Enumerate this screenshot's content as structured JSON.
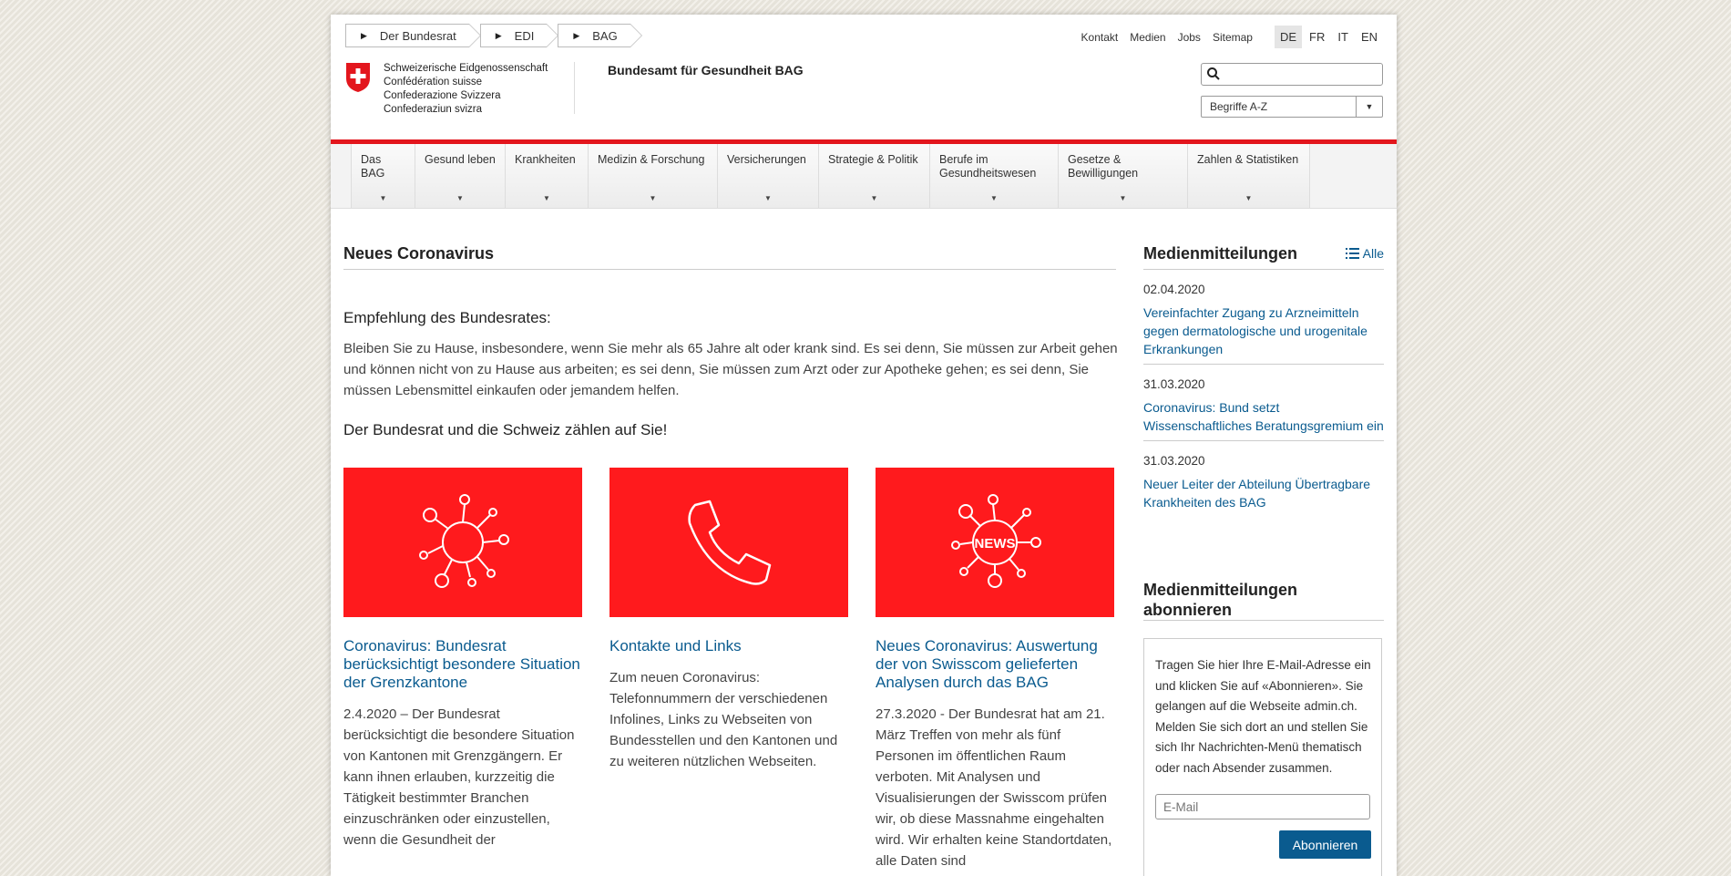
{
  "breadcrumb": [
    "Der Bundesrat",
    "EDI",
    "BAG"
  ],
  "toplinks": [
    "Kontakt",
    "Medien",
    "Jobs",
    "Sitemap"
  ],
  "languages": [
    "DE",
    "FR",
    "IT",
    "EN"
  ],
  "active_language": "DE",
  "logo": {
    "lines": [
      "Schweizerische Eidgenossenschaft",
      "Confédération suisse",
      "Confederazione Svizzera",
      "Confederaziun svizra"
    ],
    "department": "Bundesamt für Gesundheit BAG"
  },
  "search": {
    "placeholder": "",
    "icon": "search-icon"
  },
  "terms_select": "Begriffe A-Z",
  "nav": [
    {
      "label": "Das BAG"
    },
    {
      "label": "Gesund leben"
    },
    {
      "label": "Krankheiten"
    },
    {
      "label": "Medizin & Forschung"
    },
    {
      "label": "Versicherungen"
    },
    {
      "label": "Strategie & Politik"
    },
    {
      "label": "Berufe im Gesundheitswesen"
    },
    {
      "label": "Gesetze & Bewilligungen"
    },
    {
      "label": "Zahlen & Statistiken"
    }
  ],
  "main": {
    "title": "Neues Coronavirus",
    "recommendation_title": "Empfehlung des Bundesrates:",
    "recommendation_text": "Bleiben Sie zu Hause, insbesondere, wenn Sie mehr als 65 Jahre alt oder krank sind. Es sei denn, Sie müssen zur Arbeit gehen und können nicht von zu Hause aus arbeiten; es sei denn, Sie müssen zum Arzt oder zur Apotheke gehen; es sei denn, Sie müssen Lebensmittel einkaufen oder jemandem helfen.",
    "cta": "Der Bundesrat und die Schweiz zählen auf Sie!",
    "cards": [
      {
        "icon": "virus-icon",
        "title": "Coronavirus: Bundesrat berücksichtigt besondere Situation der Grenzkantone",
        "text": "2.4.2020 – Der Bundesrat berücksichtigt die besondere Situation von Kantonen mit Grenzgängern. Er kann ihnen erlauben, kurzzeitig die Tätigkeit bestimmter Branchen einzuschränken oder einzustellen, wenn die Gesundheit der"
      },
      {
        "icon": "phone-icon",
        "title": "Kontakte und Links",
        "text": "Zum neuen Coronavirus: Telefonnummern der verschiedenen Infolines, Links zu Webseiten von Bundesstellen und den Kantonen und zu weiteren nützlichen Webseiten."
      },
      {
        "icon": "news-virus-icon",
        "icon_text": "NEWS",
        "title": "Neues Coronavirus: Auswertung der von Swisscom gelieferten Analysen durch das BAG",
        "text": "27.3.2020 - Der Bundesrat hat am 21. März Treffen von mehr als fünf Personen im öffentlichen Raum verboten. Mit Analysen und Visualisierungen der Swisscom prüfen wir, ob diese Massnahme eingehalten wird. Wir erhalten keine Standortdaten, alle Daten sind"
      }
    ]
  },
  "sidebar": {
    "media_title": "Medienmitteilungen",
    "all_label": "Alle",
    "news": [
      {
        "date": "02.04.2020",
        "title": "Vereinfachter Zugang zu Arzneimitteln gegen dermatologische und urogenitale Erkrankungen"
      },
      {
        "date": "31.03.2020",
        "title": "Coronavirus: Bund setzt Wissenschaftliches Beratungsgremium ein"
      },
      {
        "date": "31.03.2020",
        "title": "Neuer Leiter der Abteilung Übertragbare Krankheiten des BAG"
      }
    ],
    "subscribe_title": "Medienmitteilungen abonnieren",
    "subscribe_text": "Tragen Sie hier Ihre E-Mail-Adresse ein und klicken Sie auf «Abonnieren». Sie gelangen auf die Webseite admin.ch. Melden Sie sich dort an und stellen Sie sich Ihr Nachrichten-Menü thematisch oder nach Absender zusammen.",
    "email_placeholder": "E-Mail",
    "subscribe_button": "Abonnieren"
  },
  "colors": {
    "accent_red": "#e3161d",
    "card_red": "#ff1a1d",
    "link_blue": "#0a5b8f"
  }
}
